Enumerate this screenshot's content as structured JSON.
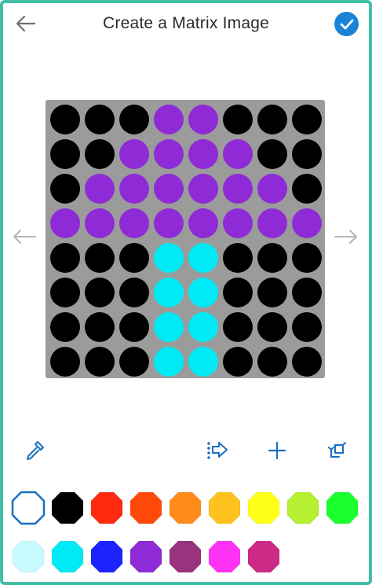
{
  "header": {
    "title": "Create a Matrix Image",
    "back_icon": "arrow-left-icon",
    "done_icon": "check-circle-icon"
  },
  "matrix": {
    "rows": 8,
    "cols": 8,
    "background": "#9b9b9b",
    "palette": {
      "K": "#000000",
      "P": "#8e2bd6",
      "C": "#00eaf5"
    },
    "cells": [
      "KKKPPKKK",
      "KKPPPPKK",
      "KPPPPPPK",
      "PPPPPPPP",
      "KKKCCKKK",
      "KKKCCKKK",
      "KKKCCKKK",
      "KKKCCKKK"
    ]
  },
  "navigation": {
    "prev_icon": "arrow-left-icon",
    "next_icon": "arrow-right-icon"
  },
  "tools": [
    {
      "name": "eyedropper-tool",
      "icon": "eyedropper-icon"
    },
    {
      "name": "shift-tool",
      "icon": "shift-right-icon"
    },
    {
      "name": "add-frame-tool",
      "icon": "plus-icon"
    },
    {
      "name": "swap-tool",
      "icon": "swap-icon"
    }
  ],
  "colors": {
    "accent": "#1a83d6",
    "frame_border": "#3fbfa6",
    "selected_swatch": "#ffffff",
    "swatches_row1": [
      "#ffffff",
      "#000000",
      "#ff2a0f",
      "#ff4a0a",
      "#ff8c1a",
      "#ffc21f",
      "#ffff1a",
      "#b5f033",
      "#1aff2e"
    ],
    "swatches_row2": [
      "#c8fbff",
      "#00eaf5",
      "#1b23ff",
      "#8e2bd6",
      "#99337f",
      "#ff33f5",
      "#cc2a85"
    ]
  }
}
